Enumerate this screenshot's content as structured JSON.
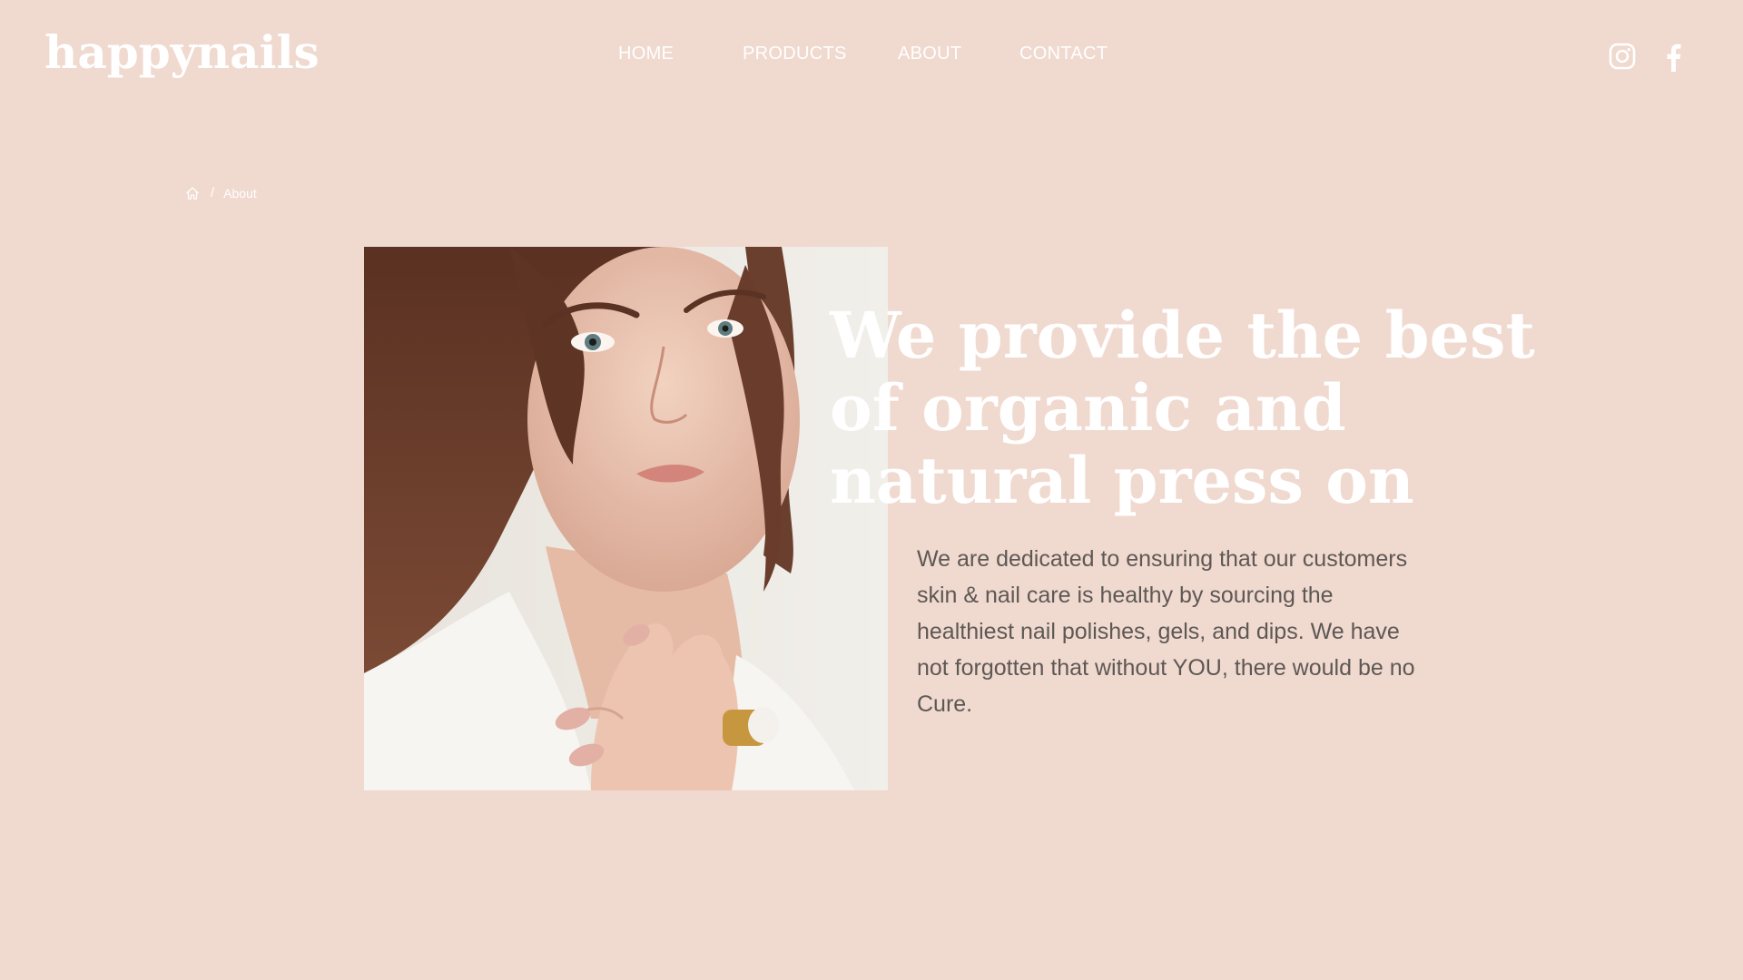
{
  "header": {
    "logo": "happynails",
    "nav": [
      "HOME",
      "PRODUCTS",
      "ABOUT",
      "CONTACT"
    ],
    "social_icons": [
      "instagram-icon",
      "facebook-icon"
    ]
  },
  "breadcrumb": {
    "home_icon": "home-icon",
    "separator": "/",
    "current": "About"
  },
  "hero": {
    "headline_lines": [
      "We provide the best",
      "of organic and",
      "natural press on"
    ],
    "body": "We are dedicated to ensuring that our customers skin & nail care is healthy by sourcing the healthiest nail polishes, gels, and dips. We have not forgotten that without YOU, there would be no Cure."
  },
  "colors": {
    "background": "#f0d9cf",
    "text_light": "#ffffff",
    "body_text": "#5e5855"
  }
}
